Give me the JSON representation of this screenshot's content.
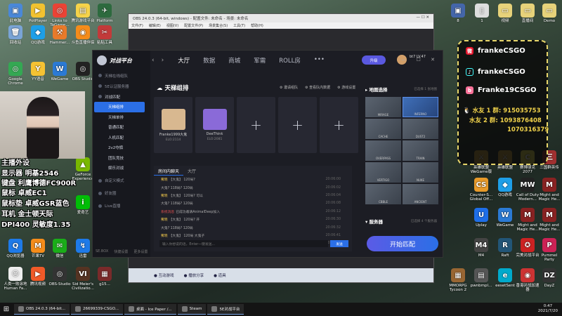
{
  "desktop_left": [
    {
      "label": "此电脑",
      "color": "#4a88d8",
      "glyph": "▣"
    },
    {
      "label": "PotPlayer",
      "color": "#f2c230",
      "glyph": "▶"
    },
    {
      "label": "Links to ToGame...",
      "color": "#ea4335",
      "glyph": "◎"
    },
    {
      "label": "腾讯游戏平台",
      "color": "#f6d34a",
      "glyph": "▤"
    },
    {
      "label": "Platform",
      "color": "#2d6a3e",
      "glyph": "✈"
    },
    {
      "label": "回收站",
      "color": "#7aa4d6",
      "glyph": "🗑"
    },
    {
      "label": "QQ游戏",
      "color": "#1e9fe8",
      "glyph": "◆"
    },
    {
      "label": "Hammer...",
      "color": "#e87a2a",
      "glyph": "⚒"
    },
    {
      "label": "斗鱼直播伴侣",
      "color": "#f58c1a",
      "glyph": "◉"
    },
    {
      "label": "粘贴工具",
      "color": "#c23a3a",
      "glyph": "✂"
    },
    {
      "label": "Google Chrome",
      "color": "#34a853",
      "glyph": "◎"
    },
    {
      "label": "YY语音",
      "color": "#f6c233",
      "glyph": "Y"
    },
    {
      "label": "WeGame",
      "color": "#2b7ad4",
      "glyph": "W"
    },
    {
      "label": "OBS Studio",
      "color": "#222222",
      "glyph": "◎"
    },
    {
      "label": "GeForce Experience",
      "color": "#7ab800",
      "glyph": "▲"
    },
    {
      "label": "爱奇艺",
      "color": "#00be06",
      "glyph": "i"
    },
    {
      "label": "QQ浏览器",
      "color": "#1e7ae8",
      "glyph": "Q"
    },
    {
      "label": "芒果TV",
      "color": "#f58c1a",
      "glyph": "M"
    },
    {
      "label": "微信",
      "color": "#1aad19",
      "glyph": "✉"
    },
    {
      "label": "迅雷",
      "color": "#1e7ae8",
      "glyph": "↯"
    },
    {
      "label": "人类一败涂地 Human Fa...",
      "color": "#eeeeee",
      "glyph": "☺"
    },
    {
      "label": "腾讯视频",
      "color": "#f05a28",
      "glyph": "▶"
    },
    {
      "label": "OBS-Studio",
      "color": "#333333",
      "glyph": "◎"
    },
    {
      "label": "Sid Meier's Civilizatio...",
      "color": "#553322",
      "glyph": "VI"
    },
    {
      "label": "g15...",
      "color": "#7a2a2a",
      "glyph": "▦"
    }
  ],
  "desktop_right": [
    {
      "label": "8",
      "color": "#4466aa",
      "glyph": "▣"
    },
    {
      "label": "1",
      "color": "#dddddd",
      "glyph": "▯"
    },
    {
      "label": "视频",
      "color": "#e7d27a",
      "glyph": "▭"
    },
    {
      "label": "直播间",
      "color": "#e7d27a",
      "glyph": "▭"
    },
    {
      "label": "Demo",
      "color": "#e7d27a",
      "glyph": "▭"
    },
    {
      "label": "英雄联盟 WeGame版",
      "color": "#c9a23a",
      "glyph": "⚔"
    },
    {
      "label": "英雄联盟",
      "color": "#c9a23a",
      "glyph": "⚔"
    },
    {
      "label": "赛博朋克 2077",
      "color": "#e8e24a",
      "glyph": "C"
    },
    {
      "label": "三国群英传",
      "color": "#a03030",
      "glyph": "三"
    },
    {
      "label": "Counter-S... Global Off...",
      "color": "#e89a2a",
      "glyph": "CS"
    },
    {
      "label": "QQ游戏",
      "color": "#1e9fe8",
      "glyph": "◆"
    },
    {
      "label": "Call of Duty Modern...",
      "color": "#222222",
      "glyph": "MW"
    },
    {
      "label": "Might and Magic He...",
      "color": "#882222",
      "glyph": "M"
    },
    {
      "label": "Uplay",
      "color": "#1e6ee8",
      "glyph": "U"
    },
    {
      "label": "WeGame",
      "color": "#2b7ad4",
      "glyph": "W"
    },
    {
      "label": "Might and Magic He...",
      "color": "#882222",
      "glyph": "M"
    },
    {
      "label": "Might and Magic He...",
      "color": "#882222",
      "glyph": "M"
    },
    {
      "label": "M4",
      "color": "#444444",
      "glyph": "M4"
    },
    {
      "label": "Raft",
      "color": "#225577",
      "glyph": "R"
    },
    {
      "label": "完美对战平台",
      "color": "#cc2222",
      "glyph": "✪"
    },
    {
      "label": "Pummel Party",
      "color": "#cc2255",
      "glyph": "P"
    },
    {
      "label": "MMORPG Tycoon 2",
      "color": "#996633",
      "glyph": "▦"
    },
    {
      "label": "pwnbmpl...",
      "color": "#555555",
      "glyph": "▤"
    },
    {
      "label": "eesetSent",
      "color": "#00aacc",
      "glyph": "e"
    },
    {
      "label": "香港对战加速器",
      "color": "#cc3333",
      "glyph": "◉"
    },
    {
      "label": "DayZ",
      "color": "#333333",
      "glyph": "DZ"
    }
  ],
  "obs": {
    "title": "OBS 24.0.3 (64-bit, windows) - 配置文件: 未命名 - 场景: 未命名",
    "menu": [
      "文件(F)",
      "编辑(E)",
      "视图(V)",
      "配置文件(P)",
      "场景集合(S)",
      "工具(T)",
      "帮助(H)"
    ],
    "bottom": [
      "互动游戏",
      "播放分享",
      "道具"
    ]
  },
  "client": {
    "logo": "对战平台",
    "sidebar": {
      "top": [
        "天梯在线组队",
        "5E认证服务器"
      ],
      "section": "对战匹配",
      "items": [
        "天梯组排",
        "天梯单排",
        "普通匹配",
        "人机匹配",
        "2v2夺旗",
        "团队竞技",
        "娱乐对战"
      ],
      "bottom": [
        "自定义模式",
        "好友圈",
        "Live直播"
      ],
      "foot": [
        "SE.BOX",
        "快捷设置",
        "更多设置"
      ]
    },
    "nav_tabs": [
      "大厅",
      "数据",
      "商城",
      "军需",
      "ROLL房",
      "•••"
    ],
    "pill": "升级",
    "user": "bt7 LV.47",
    "panel_title": "天梯组排",
    "panel_links": [
      "邀请组队",
      "查看队内数据",
      "游戏设置"
    ],
    "slots": [
      {
        "name": "Franke1999大鬼",
        "elo": "ELO:2114",
        "color": "#d8b890"
      },
      {
        "name": "DeeThink",
        "elo": "ELO:2081",
        "color": "#8a6ad8"
      }
    ],
    "chat_tabs": [
      "房间内聊天",
      "大厅"
    ],
    "chat_msgs": [
      {
        "name": "雾晓",
        "text": "【大鬼】 120局?",
        "time": "20:06:00",
        "red": false
      },
      {
        "name": "",
        "text": "大鬼? 118局? 120局",
        "time": "20:06:02",
        "red": false
      },
      {
        "name": "雾晓",
        "text": "【大鬼】 120局? 可以",
        "time": "20:06:04",
        "red": false
      },
      {
        "name": "",
        "text": "大鬼? 118局? 120局",
        "time": "20:06:08",
        "red": false
      },
      {
        "name": "系统消息",
        "text": "已成功邀请AnimalDeep加入",
        "time": "20:06:12",
        "red": true
      },
      {
        "name": "雾晓",
        "text": "【大鬼】 120局? 开",
        "time": "20:06:30",
        "red": false
      },
      {
        "name": "",
        "text": "大鬼? 118局? 120局",
        "time": "20:06:32",
        "red": false
      },
      {
        "name": "雾晓",
        "text": "【大鬼】 120局 大鬼子",
        "time": "20:06:41",
        "red": false
      },
      {
        "name": "雾晓",
        "text": "【大鬼】 120局? x4396把",
        "time": "20:06:48",
        "red": false
      }
    ],
    "chat_placeholder": "输入你想说的话，Enter一键发送...",
    "send": "发送",
    "maps_title": "地图选择",
    "maps_note": "已选择 1 张地图",
    "maps": [
      "MIRAGE",
      "INFERNO",
      "CACHE",
      "DUST2",
      "OVERPASS",
      "TRAIN",
      "VERTIGO",
      "NUKE",
      "CBBLE",
      "ANCIENT"
    ],
    "selected_map": "INFERNO",
    "server_title": "服务器",
    "server_note": "已选择 4 个服务器",
    "start": "开始匹配"
  },
  "cam_overlay": [
    "主播外设",
    "显示器 明基2546",
    "键盘 利鹰博德FC900R",
    "鼠标 卓威EC1",
    "鼠标垫 卓威GSR蓝色",
    "耳机 金士顿天际",
    "DPI400 灵敏度1.35"
  ],
  "social": {
    "weibo": "frankeCSGO",
    "douyin": "frankeCSGO",
    "bili": "Franke19CSGO",
    "qq1": "水友 1 群: 915035753",
    "qq2": "水友 2 群: 1093876408",
    "qq3": "1070316379"
  },
  "taskbar": {
    "start": "⊞",
    "items": [
      "OBS 24.0.3 (64-bit...",
      "26699339-CSGO...",
      "桌面 - Ice Paper /...",
      "Steam",
      "5E对战平台"
    ],
    "time": "0:47",
    "date": "2021/7/20"
  }
}
